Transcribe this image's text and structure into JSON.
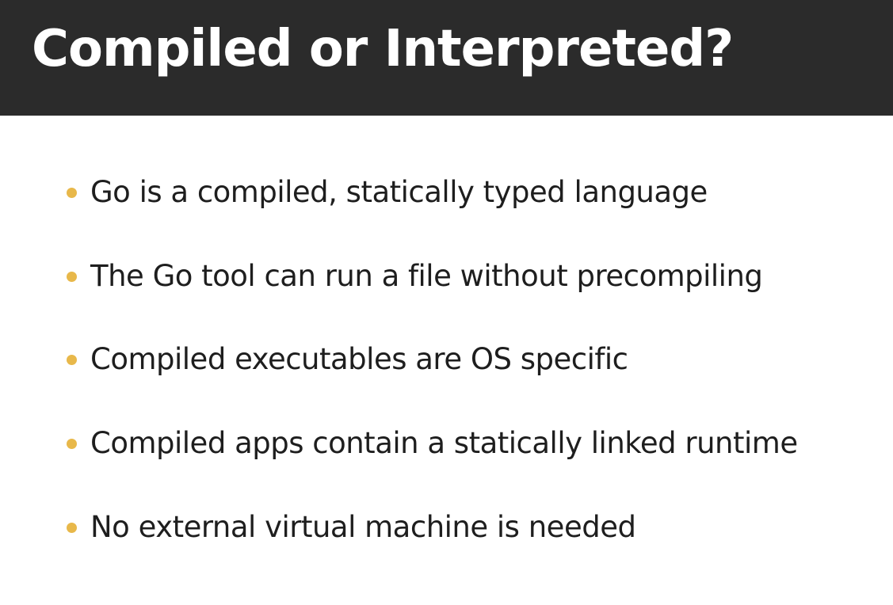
{
  "slide": {
    "title": "Compiled or Interpreted?",
    "bullets": [
      {
        "text": "Go is a compiled, statically typed language"
      },
      {
        "text": "The Go tool can run a file without precompiling"
      },
      {
        "text": "Compiled executables are OS specific"
      },
      {
        "text": "Compiled apps contain a statically linked runtime"
      },
      {
        "text": "No external virtual machine is needed"
      }
    ]
  },
  "colors": {
    "title_bar": "#2b2b2b",
    "title_text": "#ffffff",
    "bullet_dot": "#e8b84a",
    "body_text": "#1e1e1e",
    "background": "#ffffff"
  }
}
